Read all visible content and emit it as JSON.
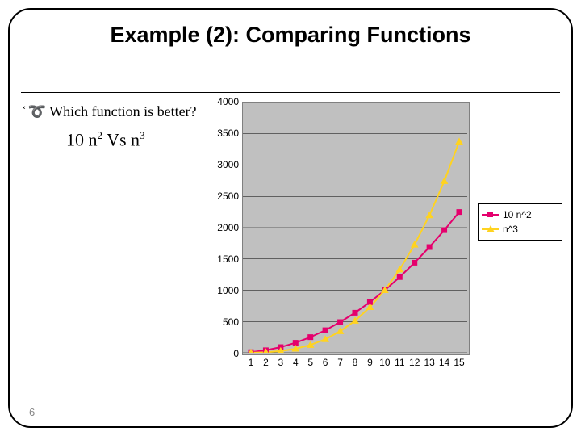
{
  "title": "Example (2): Comparing Functions",
  "bullet": "Which function is better?",
  "comparison": {
    "a": "10 n",
    "a_exp": "2",
    "vs": " Vs n",
    "b_exp": "3"
  },
  "slide_number": "6",
  "legend": {
    "s1": "10 n^2",
    "s2": "n^3"
  },
  "chart_data": {
    "type": "line",
    "title": "",
    "xlabel": "",
    "ylabel": "",
    "ylim": [
      0,
      4000
    ],
    "xlim": [
      1,
      15
    ],
    "yticks": [
      0,
      500,
      1000,
      1500,
      2000,
      2500,
      3000,
      3500,
      4000
    ],
    "categories": [
      1,
      2,
      3,
      4,
      5,
      6,
      7,
      8,
      9,
      10,
      11,
      12,
      13,
      14,
      15
    ],
    "series": [
      {
        "name": "10 n^2",
        "values": [
          10,
          40,
          90,
          160,
          250,
          360,
          490,
          640,
          810,
          1000,
          1210,
          1440,
          1690,
          1960,
          2250
        ]
      },
      {
        "name": "n^3",
        "values": [
          1,
          8,
          27,
          64,
          125,
          216,
          343,
          512,
          729,
          1000,
          1331,
          1728,
          2197,
          2744,
          3375
        ]
      }
    ]
  }
}
